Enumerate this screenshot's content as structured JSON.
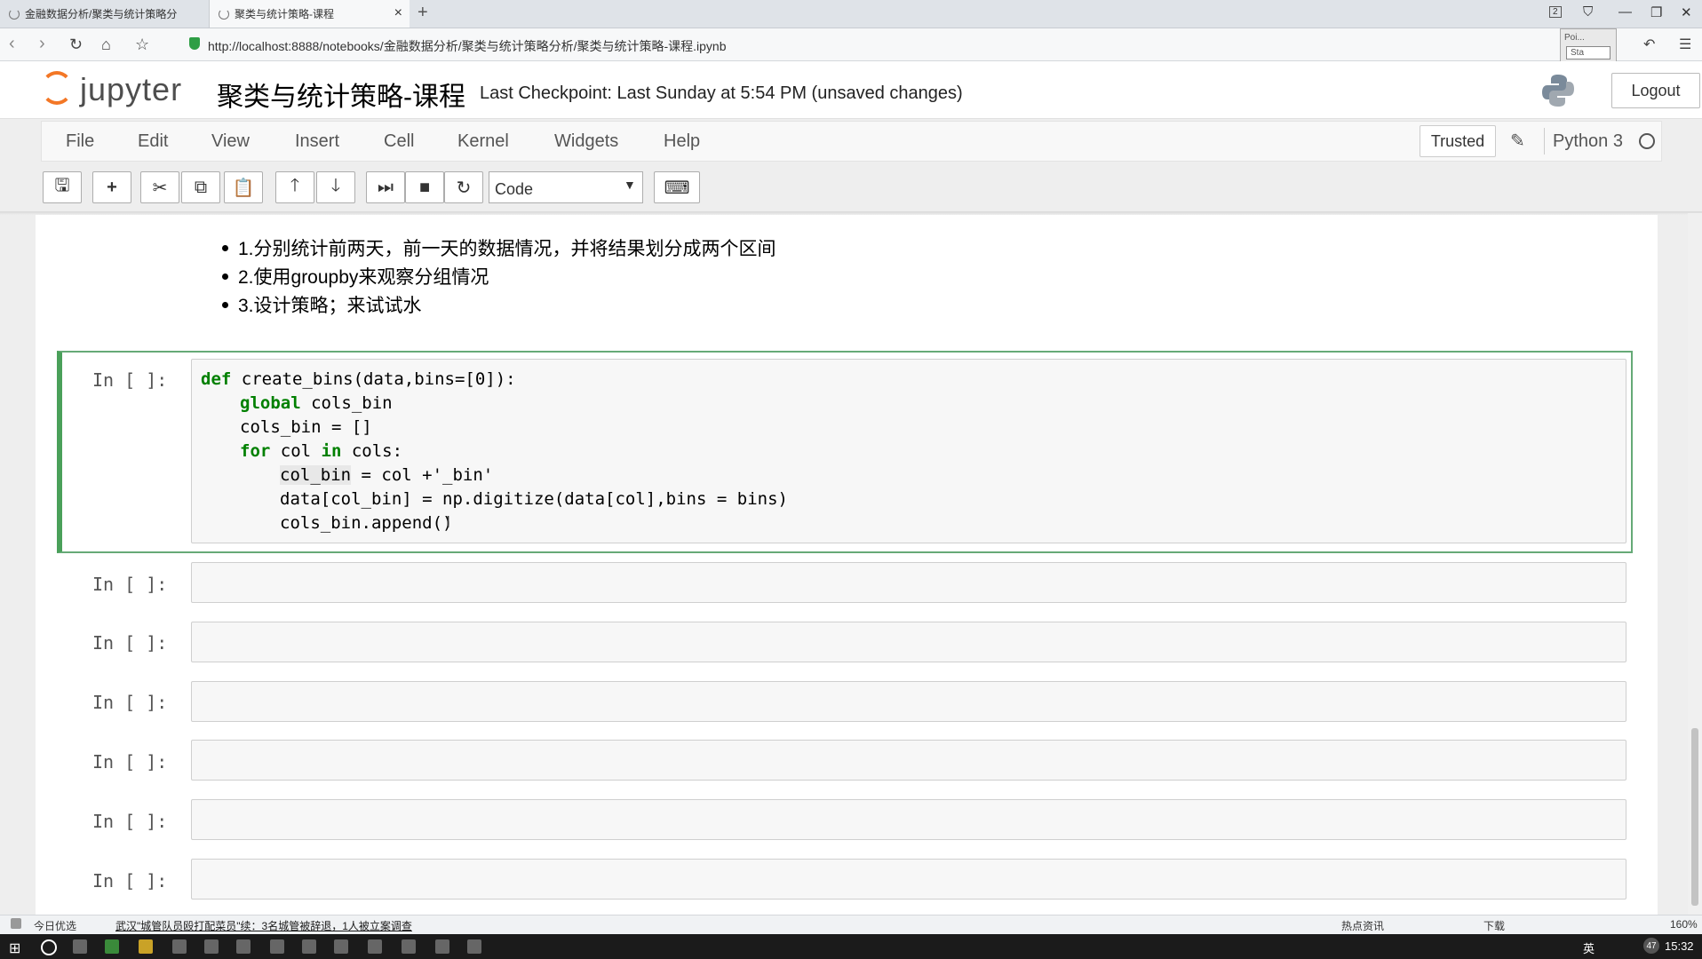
{
  "browser": {
    "tabs": [
      {
        "label": "金融数据分析/聚类与统计策略分"
      },
      {
        "label": "聚类与统计策略-课程"
      }
    ],
    "tab_badge": "2",
    "url": "http://localhost:8888/notebooks/金融数据分析/聚类与统计策略分析/聚类与统计策略-课程.ipynb",
    "popup": {
      "line1": "Poi...",
      "line2": "Sta"
    }
  },
  "jupyter": {
    "logo_text": "jupyter",
    "notebook_title": "聚类与统计策略-课程",
    "checkpoint": "Last Checkpoint: Last Sunday at 5:54 PM (unsaved changes)",
    "logout_label": "Logout",
    "menu": [
      "File",
      "Edit",
      "View",
      "Insert",
      "Cell",
      "Kernel",
      "Widgets",
      "Help"
    ],
    "trusted_label": "Trusted",
    "kernel_name": "Python 3",
    "cell_type": "Code"
  },
  "markdown": {
    "bullets": [
      "1.分别统计前两天，前一天的数据情况，并将结果划分成两个区间",
      "2.使用groupby来观察分组情况",
      "3.设计策略；来试试水"
    ]
  },
  "prompt": "In  [  ]:",
  "code": {
    "l1_kw": "def",
    "l1_rest": " create_bins(data,bins=[0]):",
    "l2_kw": "global",
    "l2_rest": " cols_bin",
    "l3": "cols_bin = []",
    "l4_kw1": "for",
    "l4_mid": " col ",
    "l4_kw2": "in",
    "l4_rest": " cols:",
    "l5_hl": "col_bin",
    "l5_rest": " = col +'_bin'",
    "l6": "data[col_bin] = np.digitize(data[col],bins = bins)",
    "l7": "cols_bin.append()"
  },
  "statusbar": {
    "today": "今日优选",
    "news": "武汉\"城管队员殴打配菜员\"续：3名城管被辞退，1人被立案调查",
    "hot": "热点资讯",
    "download": "下载",
    "zoom": "160%"
  },
  "taskbar": {
    "ime": "英",
    "clock": "15:32",
    "temp": "47"
  }
}
